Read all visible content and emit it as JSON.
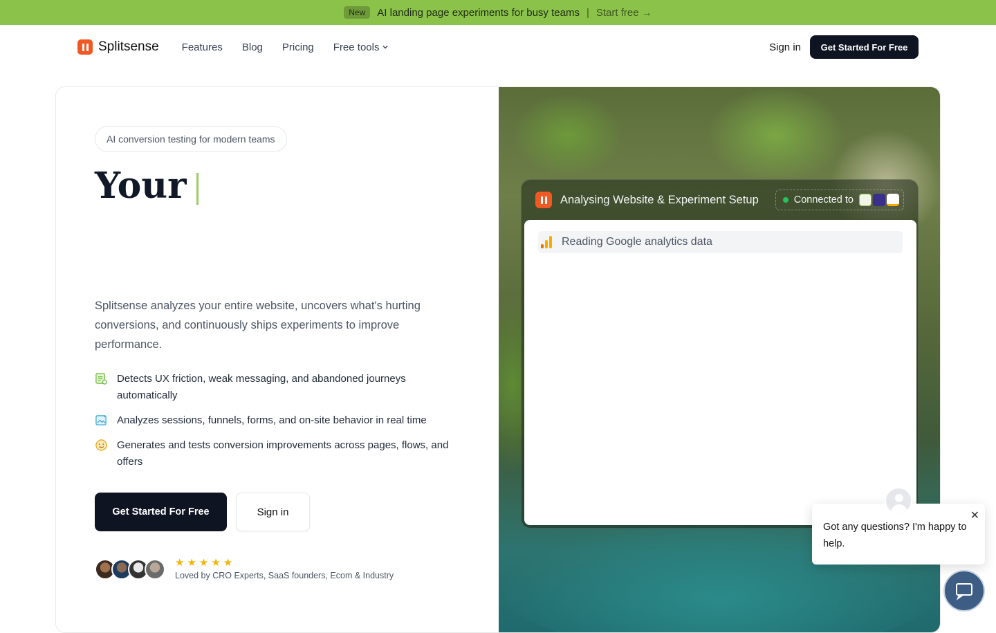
{
  "banner": {
    "badge": "New",
    "message": "AI landing page experiments for busy teams",
    "separator": "|",
    "link": "Start free →"
  },
  "nav": {
    "brand": "Splitsense",
    "links": [
      "Features",
      "Blog",
      "Pricing",
      "Free tools"
    ],
    "signin": "Sign in",
    "cta": "Get Started For Free"
  },
  "hero": {
    "pill": "AI conversion testing for modern teams",
    "headline": "Your",
    "description": "Splitsense analyzes your entire website, uncovers what's hurting conversions, and continuously ships experiments to improve performance.",
    "features": [
      "Detects UX friction, weak messaging, and abandoned journeys automatically",
      "Analyzes sessions, funnels, forms, and on-site behavior in real time",
      "Generates and tests conversion improvements across pages, flows, and offers"
    ],
    "cta_primary": "Get Started For Free",
    "cta_secondary": "Sign in",
    "rating_stars": 5,
    "social_proof": "Loved by CRO Experts, SaaS founders, Ecom & Industry"
  },
  "panel": {
    "title": "Analysing Website & Experiment Setup",
    "connected_label": "Connected to",
    "task": "Reading Google analytics data"
  },
  "chat": {
    "message": "Got any questions? I'm happy to help.",
    "close": "✕"
  },
  "colors": {
    "banner": "#8bc34a",
    "brand": "#ef5a24",
    "dark_button": "#0f1422",
    "star": "#f5b400",
    "chat_launcher": "#3d5d85"
  }
}
